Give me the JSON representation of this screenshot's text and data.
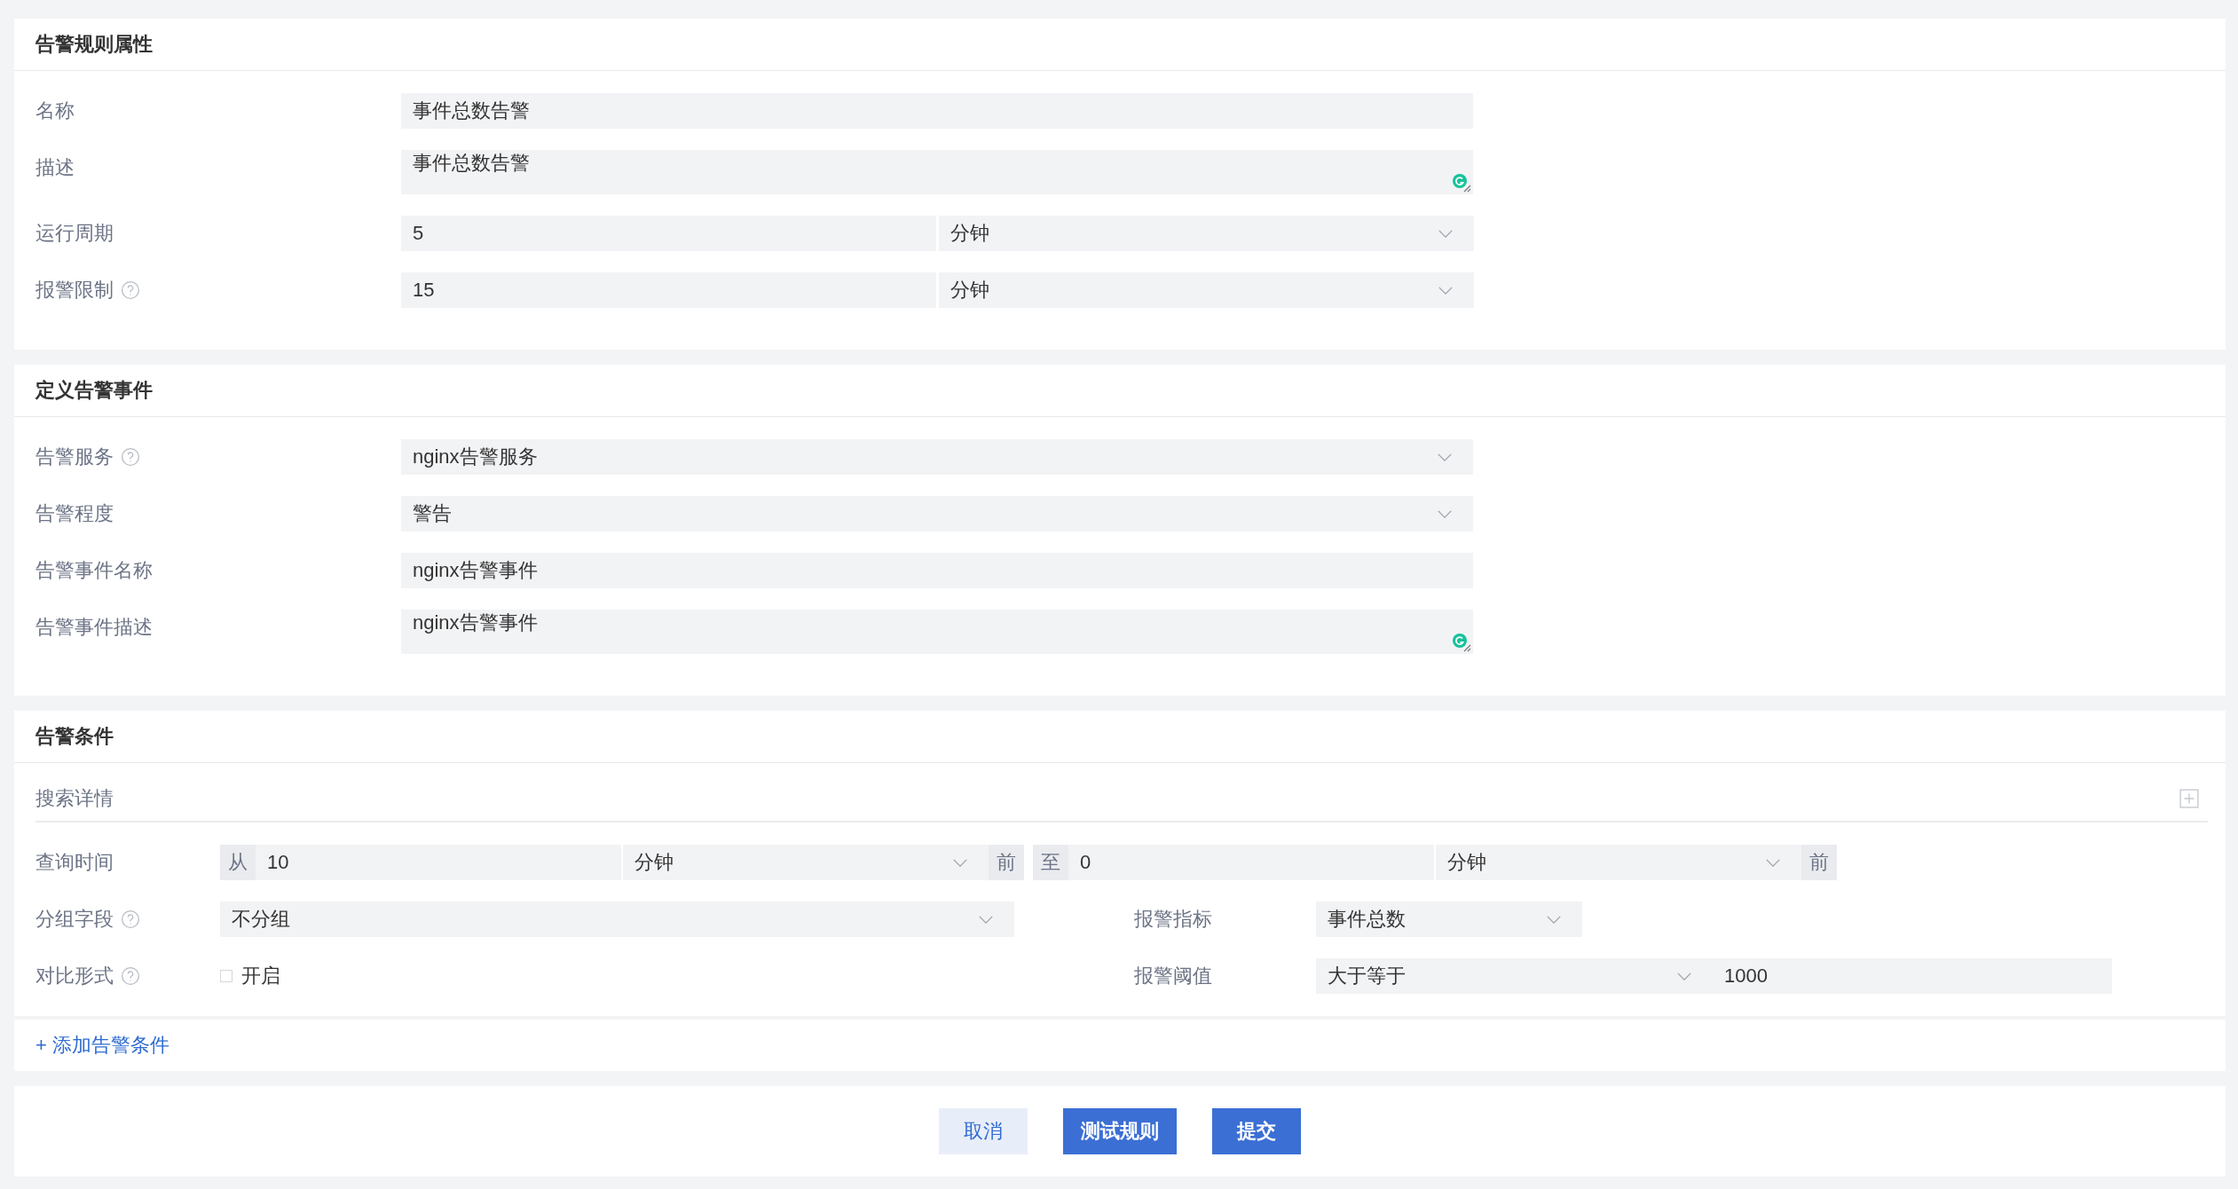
{
  "rule_properties": {
    "title": "告警规则属性",
    "fields": [
      {
        "label": "名称",
        "help": false,
        "kind": "text",
        "value": "事件总数告警"
      },
      {
        "label": "描述",
        "help": false,
        "kind": "textarea",
        "value": "事件总数告警"
      },
      {
        "label": "运行周期",
        "help": false,
        "kind": "number_unit",
        "value": "5",
        "unit": "分钟"
      },
      {
        "label": "报警限制",
        "help": true,
        "kind": "number_unit",
        "value": "15",
        "unit": "分钟"
      }
    ]
  },
  "alert_event": {
    "title": "定义告警事件",
    "fields": [
      {
        "label": "告警服务",
        "help": true,
        "kind": "select",
        "value": "nginx告警服务"
      },
      {
        "label": "告警程度",
        "help": false,
        "kind": "select",
        "value": "警告"
      },
      {
        "label": "告警事件名称",
        "help": false,
        "kind": "text",
        "value": "nginx告警事件"
      },
      {
        "label": "告警事件描述",
        "help": false,
        "kind": "textarea",
        "value": "nginx告警事件"
      }
    ]
  },
  "conditions": {
    "title": "告警条件",
    "search_title": "搜索详情",
    "query_time": {
      "label": "查询时间",
      "from_prefix": "从",
      "from_value": "10",
      "from_unit": "分钟",
      "from_suffix": "前",
      "to_prefix": "至",
      "to_value": "0",
      "to_unit": "分钟",
      "to_suffix": "前"
    },
    "group_field": {
      "label": "分组字段",
      "help": true,
      "value": "不分组"
    },
    "compare": {
      "label": "对比形式",
      "help": true,
      "checked": false,
      "option": "开启"
    },
    "metric": {
      "label": "报警指标",
      "value": "事件总数"
    },
    "threshold": {
      "label": "报警阈值",
      "operator": "大于等于",
      "value": "1000"
    },
    "add_link": "+ 添加告警条件"
  },
  "buttons": [
    {
      "label": "取消",
      "kind": "secondary"
    },
    {
      "label": "测试规则",
      "kind": "primary"
    },
    {
      "label": "提交",
      "kind": "primary"
    }
  ]
}
